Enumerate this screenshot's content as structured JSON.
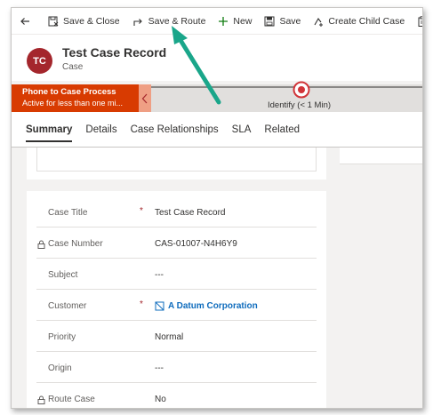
{
  "toolbar": {
    "back_icon": "back-arrow-icon",
    "items": [
      {
        "label": "Save & Close",
        "icon": "save-close-icon"
      },
      {
        "label": "Save & Route",
        "icon": "route-icon"
      },
      {
        "label": "New",
        "icon": "plus-icon"
      },
      {
        "label": "Save",
        "icon": "save-icon"
      },
      {
        "label": "Create Child Case",
        "icon": "child-case-icon"
      },
      {
        "label": "Co",
        "icon": "clipboard-icon"
      }
    ]
  },
  "header": {
    "avatar_initials": "TC",
    "title": "Test Case Record",
    "entity": "Case",
    "avatar_color": "#a4262c"
  },
  "bpf": {
    "process_name": "Phone to Case Process",
    "active_time": "Active for less than one mi...",
    "stage_name": "Identify",
    "stage_duration": "(< 1 Min)",
    "accent_color": "#d83b01"
  },
  "tabs": [
    {
      "label": "Summary",
      "active": true
    },
    {
      "label": "Details",
      "active": false
    },
    {
      "label": "Case Relationships",
      "active": false
    },
    {
      "label": "SLA",
      "active": false
    },
    {
      "label": "Related",
      "active": false
    }
  ],
  "form": {
    "fields": [
      {
        "label": "Case Title",
        "value": "Test Case Record",
        "required": true,
        "locked": false
      },
      {
        "label": "Case Number",
        "value": "CAS-01007-N4H6Y9",
        "required": false,
        "locked": true
      },
      {
        "label": "Subject",
        "value": "---",
        "required": false,
        "locked": false
      },
      {
        "label": "Customer",
        "value": "A Datum Corporation",
        "required": true,
        "locked": false,
        "link": true
      },
      {
        "label": "Priority",
        "value": "Normal",
        "required": false,
        "locked": false
      },
      {
        "label": "Origin",
        "value": "---",
        "required": false,
        "locked": false
      },
      {
        "label": "Route Case",
        "value": "No",
        "required": false,
        "locked": true
      }
    ],
    "required_marker": "*"
  },
  "annotation": {
    "arrow_color": "#1aa68a",
    "points_to": "Save & Route"
  }
}
